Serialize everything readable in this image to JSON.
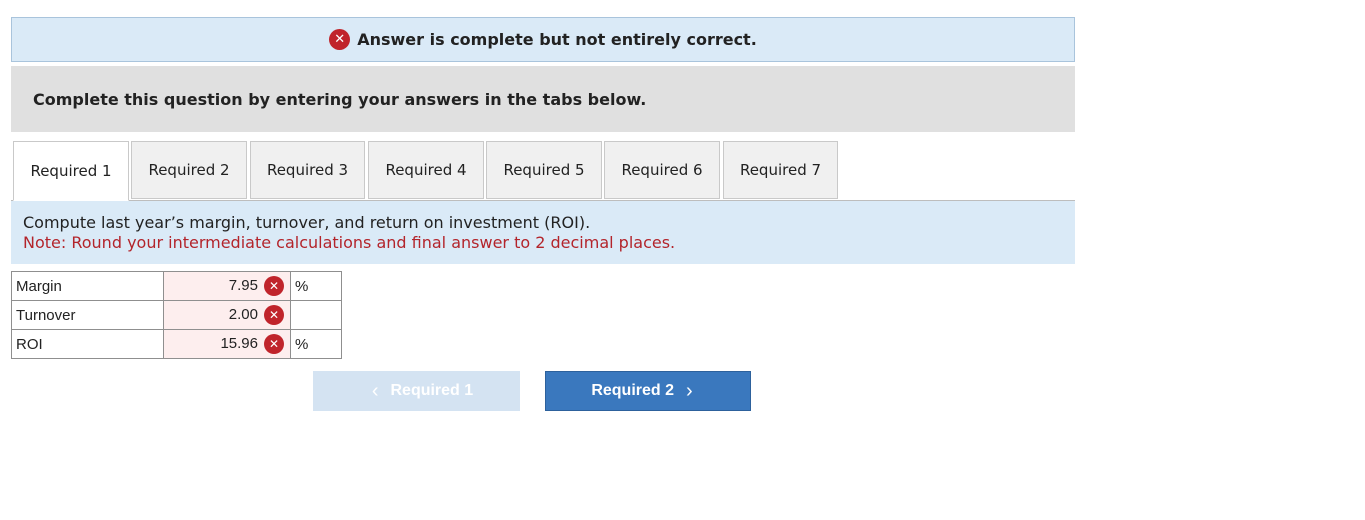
{
  "banner": {
    "icon": "x-circle-icon",
    "text": "Answer is complete but not entirely correct."
  },
  "instruction": "Complete this question by entering your answers in the tabs below.",
  "tabs": [
    {
      "label": "Required 1",
      "active": true
    },
    {
      "label": "Required 2"
    },
    {
      "label": "Required 3"
    },
    {
      "label": "Required 4"
    },
    {
      "label": "Required 5"
    },
    {
      "label": "Required 6"
    },
    {
      "label": "Required 7"
    }
  ],
  "question": {
    "text": "Compute last year’s margin, turnover, and return on investment (ROI).",
    "note": "Note: Round your intermediate calculations and final answer to 2 decimal places."
  },
  "answers": [
    {
      "label": "Margin",
      "value": "7.95",
      "unit": "%",
      "status": "incorrect"
    },
    {
      "label": "Turnover",
      "value": "2.00",
      "unit": "",
      "status": "incorrect"
    },
    {
      "label": "ROI",
      "value": "15.96",
      "unit": "%",
      "status": "incorrect"
    }
  ],
  "nav": {
    "prev_label": "Required 1",
    "next_label": "Required 2"
  },
  "colors": {
    "error": "#c0242b",
    "banner_bg": "#daeaf7",
    "next_bg": "#3a78be",
    "note_text": "#b3242b"
  }
}
